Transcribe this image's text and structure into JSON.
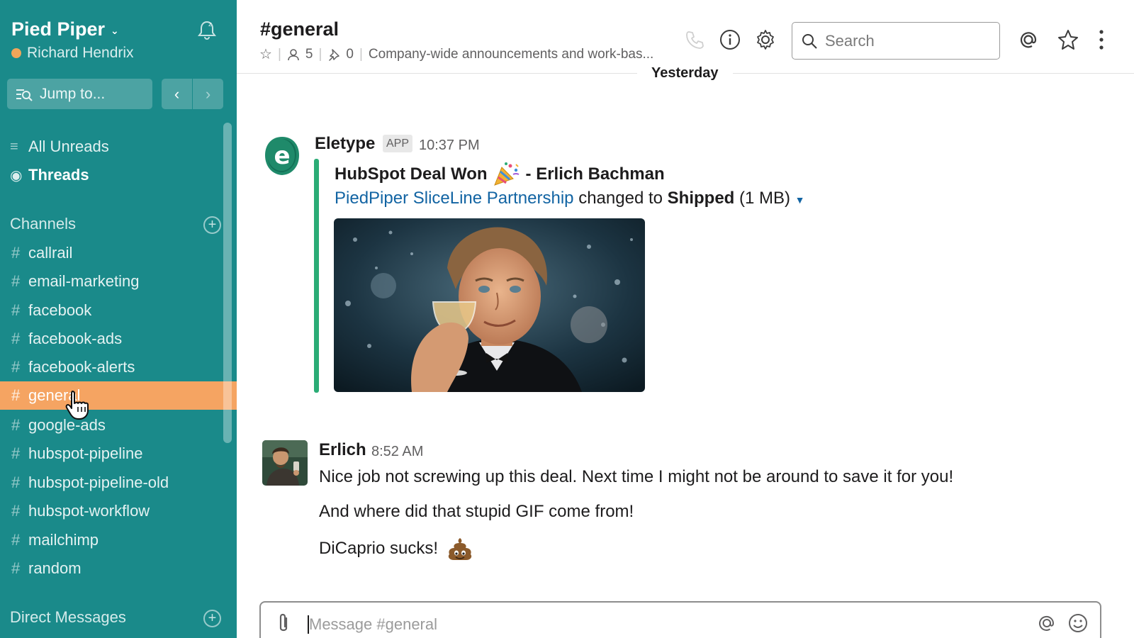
{
  "sidebar": {
    "workspace": "Pied Piper",
    "user": "Richard Hendrix",
    "jump_to": "Jump to...",
    "all_unreads": "All Unreads",
    "threads": "Threads",
    "channels_heading": "Channels",
    "channels": [
      {
        "name": "callrail"
      },
      {
        "name": "email-marketing"
      },
      {
        "name": "facebook"
      },
      {
        "name": "facebook-ads"
      },
      {
        "name": "facebook-alerts"
      },
      {
        "name": "general",
        "active": true
      },
      {
        "name": "google-ads"
      },
      {
        "name": "hubspot-pipeline"
      },
      {
        "name": "hubspot-pipeline-old"
      },
      {
        "name": "hubspot-workflow"
      },
      {
        "name": "mailchimp"
      },
      {
        "name": "random"
      }
    ],
    "dm_heading": "Direct Messages",
    "accent_color": "#1a8a8a",
    "active_color": "#f5a462"
  },
  "header": {
    "channel": "#general",
    "members": "5",
    "pins": "0",
    "topic": "Company-wide announcements and work-bas...",
    "search_placeholder": "Search"
  },
  "day_divider": "Yesterday",
  "messages": [
    {
      "author": "Eletype",
      "badge": "APP",
      "time": "10:37 PM",
      "attachment": {
        "title_before": "HubSpot Deal Won",
        "title_after": "- Erlich Bachman",
        "link": "PiedPiper SliceLine Partnership",
        "changed_to": "changed to",
        "status": "Shipped",
        "size": "(1 MB)"
      }
    },
    {
      "author": "Erlich",
      "time": "8:52 AM",
      "lines": [
        "Nice job not screwing up this deal. Next time I might not be around to save it for you!",
        "And where did that stupid GIF come from!",
        "DiCaprio sucks!"
      ]
    }
  ],
  "composer": {
    "placeholder": "Message #general"
  }
}
